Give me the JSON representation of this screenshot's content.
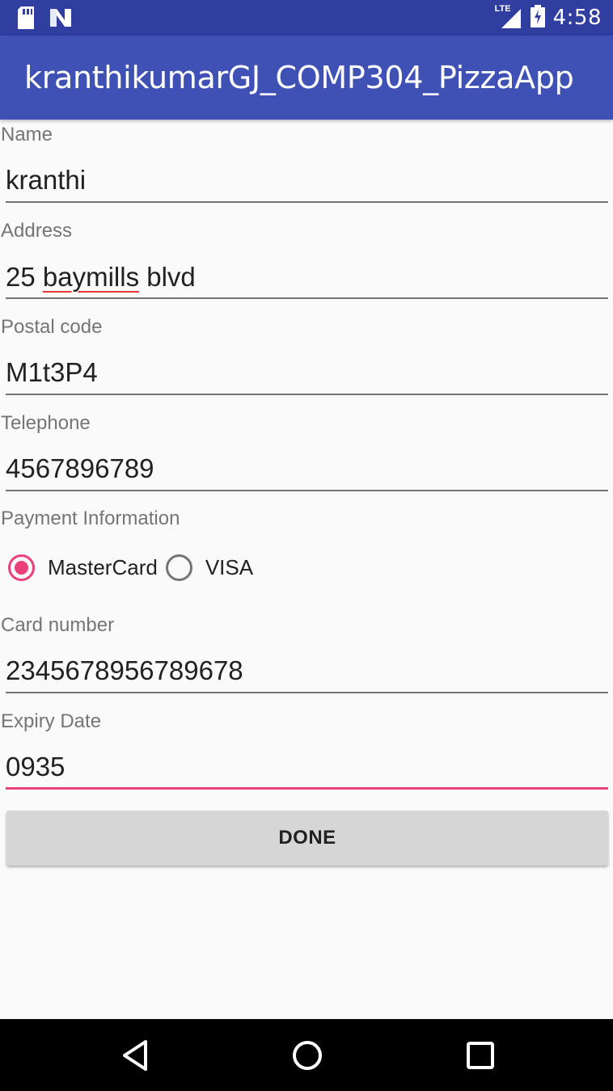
{
  "status_bar": {
    "time": "4:58",
    "network_label": "LTE",
    "icons": [
      "sd-card-icon",
      "notification-n-icon",
      "lte-signal-icon",
      "battery-charging-icon"
    ]
  },
  "app_bar": {
    "title": "kranthikumarGJ_COMP304_PizzaApp"
  },
  "form": {
    "name": {
      "label": "Name",
      "value": "kranthi"
    },
    "address": {
      "label": "Address",
      "value_prefix": "25 ",
      "value_misspelled": "baymills",
      "value_suffix": " blvd"
    },
    "postal_code": {
      "label": "Postal code",
      "value": "M1t3P4"
    },
    "telephone": {
      "label": "Telephone",
      "value": "4567896789"
    },
    "payment": {
      "label": "Payment Information",
      "options": [
        "MasterCard",
        "VISA"
      ],
      "selected": "MasterCard"
    },
    "card_number": {
      "label": "Card number",
      "value": "2345678956789678"
    },
    "expiry_date": {
      "label": "Expiry Date",
      "value": "0935"
    },
    "done_label": "DONE"
  },
  "colors": {
    "status_bar": "#303f9f",
    "app_bar": "#3f51b5",
    "accent": "#ec407a",
    "background": "#fafafa"
  },
  "nav_bar": {
    "icons": [
      "back-icon",
      "home-icon",
      "recents-icon"
    ]
  }
}
